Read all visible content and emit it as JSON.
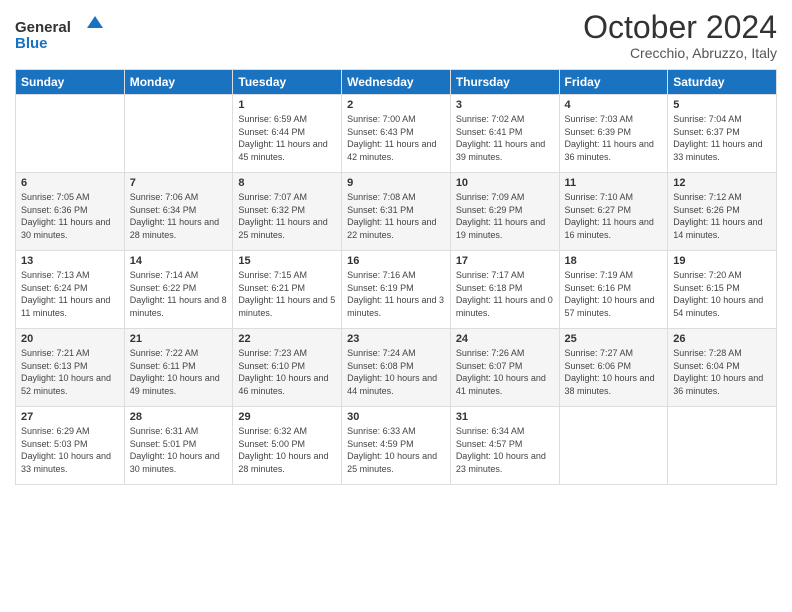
{
  "logo": {
    "line1": "General",
    "line2": "Blue"
  },
  "title": "October 2024",
  "subtitle": "Crecchio, Abruzzo, Italy",
  "weekdays": [
    "Sunday",
    "Monday",
    "Tuesday",
    "Wednesday",
    "Thursday",
    "Friday",
    "Saturday"
  ],
  "weeks": [
    [
      {
        "day": "",
        "info": ""
      },
      {
        "day": "",
        "info": ""
      },
      {
        "day": "1",
        "info": "Sunrise: 6:59 AM\nSunset: 6:44 PM\nDaylight: 11 hours and 45 minutes."
      },
      {
        "day": "2",
        "info": "Sunrise: 7:00 AM\nSunset: 6:43 PM\nDaylight: 11 hours and 42 minutes."
      },
      {
        "day": "3",
        "info": "Sunrise: 7:02 AM\nSunset: 6:41 PM\nDaylight: 11 hours and 39 minutes."
      },
      {
        "day": "4",
        "info": "Sunrise: 7:03 AM\nSunset: 6:39 PM\nDaylight: 11 hours and 36 minutes."
      },
      {
        "day": "5",
        "info": "Sunrise: 7:04 AM\nSunset: 6:37 PM\nDaylight: 11 hours and 33 minutes."
      }
    ],
    [
      {
        "day": "6",
        "info": "Sunrise: 7:05 AM\nSunset: 6:36 PM\nDaylight: 11 hours and 30 minutes."
      },
      {
        "day": "7",
        "info": "Sunrise: 7:06 AM\nSunset: 6:34 PM\nDaylight: 11 hours and 28 minutes."
      },
      {
        "day": "8",
        "info": "Sunrise: 7:07 AM\nSunset: 6:32 PM\nDaylight: 11 hours and 25 minutes."
      },
      {
        "day": "9",
        "info": "Sunrise: 7:08 AM\nSunset: 6:31 PM\nDaylight: 11 hours and 22 minutes."
      },
      {
        "day": "10",
        "info": "Sunrise: 7:09 AM\nSunset: 6:29 PM\nDaylight: 11 hours and 19 minutes."
      },
      {
        "day": "11",
        "info": "Sunrise: 7:10 AM\nSunset: 6:27 PM\nDaylight: 11 hours and 16 minutes."
      },
      {
        "day": "12",
        "info": "Sunrise: 7:12 AM\nSunset: 6:26 PM\nDaylight: 11 hours and 14 minutes."
      }
    ],
    [
      {
        "day": "13",
        "info": "Sunrise: 7:13 AM\nSunset: 6:24 PM\nDaylight: 11 hours and 11 minutes."
      },
      {
        "day": "14",
        "info": "Sunrise: 7:14 AM\nSunset: 6:22 PM\nDaylight: 11 hours and 8 minutes."
      },
      {
        "day": "15",
        "info": "Sunrise: 7:15 AM\nSunset: 6:21 PM\nDaylight: 11 hours and 5 minutes."
      },
      {
        "day": "16",
        "info": "Sunrise: 7:16 AM\nSunset: 6:19 PM\nDaylight: 11 hours and 3 minutes."
      },
      {
        "day": "17",
        "info": "Sunrise: 7:17 AM\nSunset: 6:18 PM\nDaylight: 11 hours and 0 minutes."
      },
      {
        "day": "18",
        "info": "Sunrise: 7:19 AM\nSunset: 6:16 PM\nDaylight: 10 hours and 57 minutes."
      },
      {
        "day": "19",
        "info": "Sunrise: 7:20 AM\nSunset: 6:15 PM\nDaylight: 10 hours and 54 minutes."
      }
    ],
    [
      {
        "day": "20",
        "info": "Sunrise: 7:21 AM\nSunset: 6:13 PM\nDaylight: 10 hours and 52 minutes."
      },
      {
        "day": "21",
        "info": "Sunrise: 7:22 AM\nSunset: 6:11 PM\nDaylight: 10 hours and 49 minutes."
      },
      {
        "day": "22",
        "info": "Sunrise: 7:23 AM\nSunset: 6:10 PM\nDaylight: 10 hours and 46 minutes."
      },
      {
        "day": "23",
        "info": "Sunrise: 7:24 AM\nSunset: 6:08 PM\nDaylight: 10 hours and 44 minutes."
      },
      {
        "day": "24",
        "info": "Sunrise: 7:26 AM\nSunset: 6:07 PM\nDaylight: 10 hours and 41 minutes."
      },
      {
        "day": "25",
        "info": "Sunrise: 7:27 AM\nSunset: 6:06 PM\nDaylight: 10 hours and 38 minutes."
      },
      {
        "day": "26",
        "info": "Sunrise: 7:28 AM\nSunset: 6:04 PM\nDaylight: 10 hours and 36 minutes."
      }
    ],
    [
      {
        "day": "27",
        "info": "Sunrise: 6:29 AM\nSunset: 5:03 PM\nDaylight: 10 hours and 33 minutes."
      },
      {
        "day": "28",
        "info": "Sunrise: 6:31 AM\nSunset: 5:01 PM\nDaylight: 10 hours and 30 minutes."
      },
      {
        "day": "29",
        "info": "Sunrise: 6:32 AM\nSunset: 5:00 PM\nDaylight: 10 hours and 28 minutes."
      },
      {
        "day": "30",
        "info": "Sunrise: 6:33 AM\nSunset: 4:59 PM\nDaylight: 10 hours and 25 minutes."
      },
      {
        "day": "31",
        "info": "Sunrise: 6:34 AM\nSunset: 4:57 PM\nDaylight: 10 hours and 23 minutes."
      },
      {
        "day": "",
        "info": ""
      },
      {
        "day": "",
        "info": ""
      }
    ]
  ]
}
